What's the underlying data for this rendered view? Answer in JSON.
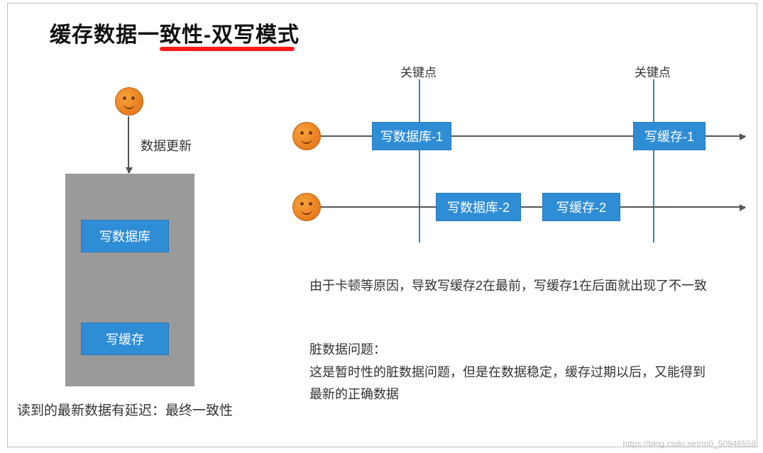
{
  "title": "缓存数据一致性-双写模式",
  "left": {
    "update_label": "数据更新",
    "write_db": "写数据库",
    "write_cache": "写缓存",
    "caption": "读到的最新数据有延迟：最终一致性"
  },
  "right": {
    "key_point": "关键点",
    "row1": {
      "write_db": "写数据库-1",
      "write_cache": "写缓存-1"
    },
    "row2": {
      "write_db": "写数据库-2",
      "write_cache": "写缓存-2"
    },
    "explain1": "由于卡顿等原因，导致写缓存2在最前，写缓存1在后面就出现了不一致",
    "dirty_title": "脏数据问题：",
    "dirty_body": "这是暂时性的脏数据问题，但是在数据稳定，缓存过期以后，又能得到最新的正确数据"
  },
  "watermark": "https://blog.csdn.net/m0_50946558"
}
